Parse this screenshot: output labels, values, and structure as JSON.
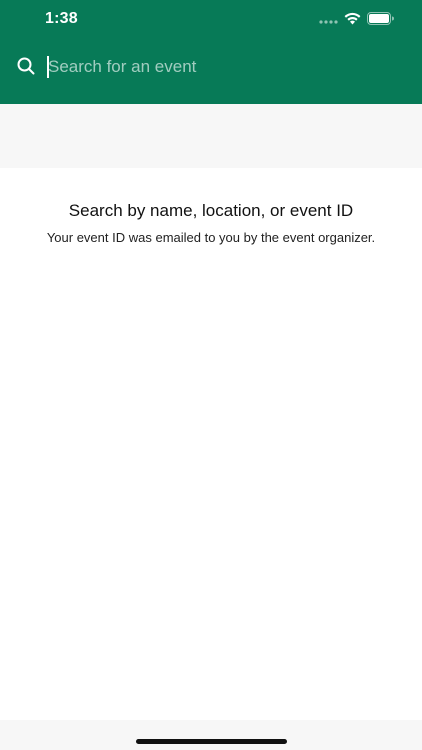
{
  "status_bar": {
    "time": "1:38",
    "icons": [
      "signal-icon",
      "wifi-icon",
      "battery-icon"
    ]
  },
  "search": {
    "placeholder": "Search for an event",
    "value": "",
    "icon": "search-icon"
  },
  "empty_state": {
    "title": "Search by name, location, or event ID",
    "subtitle": "Your event ID was emailed to you by the event organizer."
  },
  "colors": {
    "header_bg": "#077a57",
    "band_bg": "#f7f7f7",
    "text": "#111111"
  }
}
